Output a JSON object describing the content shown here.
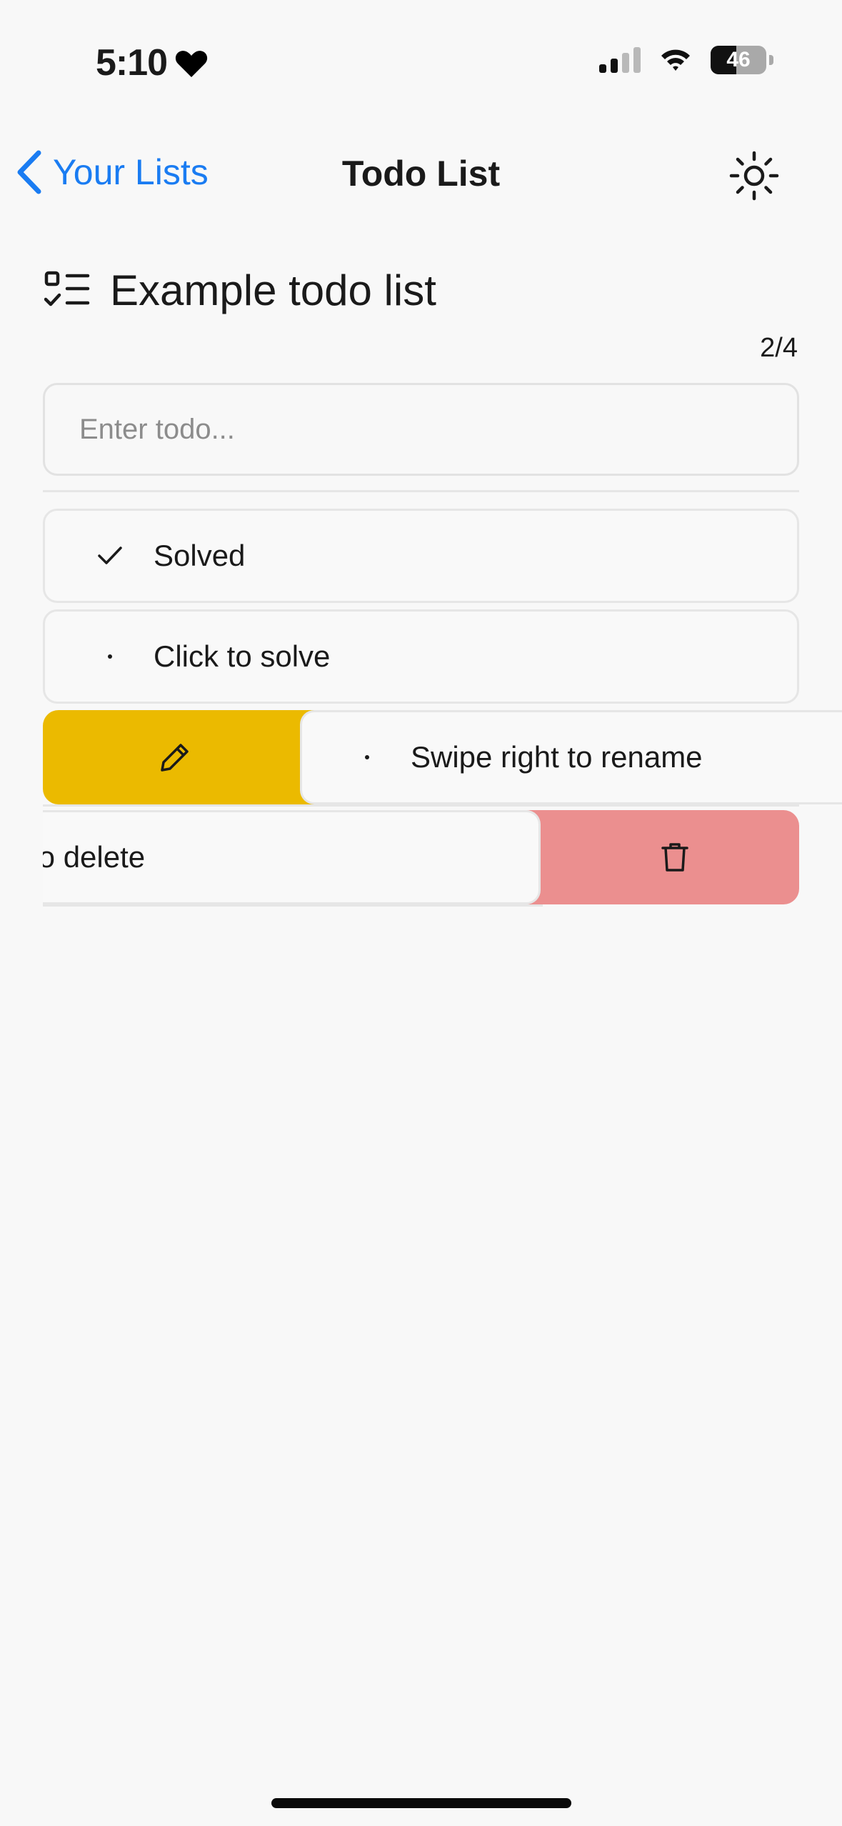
{
  "status_bar": {
    "time": "5:10",
    "battery": "46",
    "heart_icon": "heart-icon"
  },
  "nav": {
    "back_label": "Your Lists",
    "title": "Todo List",
    "theme_icon": "sun-icon"
  },
  "list": {
    "title": "Example todo list",
    "icon": "checklist-icon",
    "counter": "2/4",
    "input_placeholder": "Enter todo..."
  },
  "todos": [
    {
      "label": "Solved",
      "state": "solved",
      "icon": "checkmark-icon"
    },
    {
      "label": "Click to solve",
      "state": "open",
      "icon": "dot-icon"
    },
    {
      "label": "Swipe right to rename",
      "state": "open",
      "icon": "dot-icon",
      "swiped": "right",
      "action_icon": "pencil-icon"
    },
    {
      "label": "to delete",
      "state": "open",
      "swiped": "left",
      "action_icon": "trash-icon"
    }
  ],
  "colors": {
    "accent": "#1a7cf2",
    "rename_action": "#ebba00",
    "delete_action": "#eb8f8f"
  }
}
